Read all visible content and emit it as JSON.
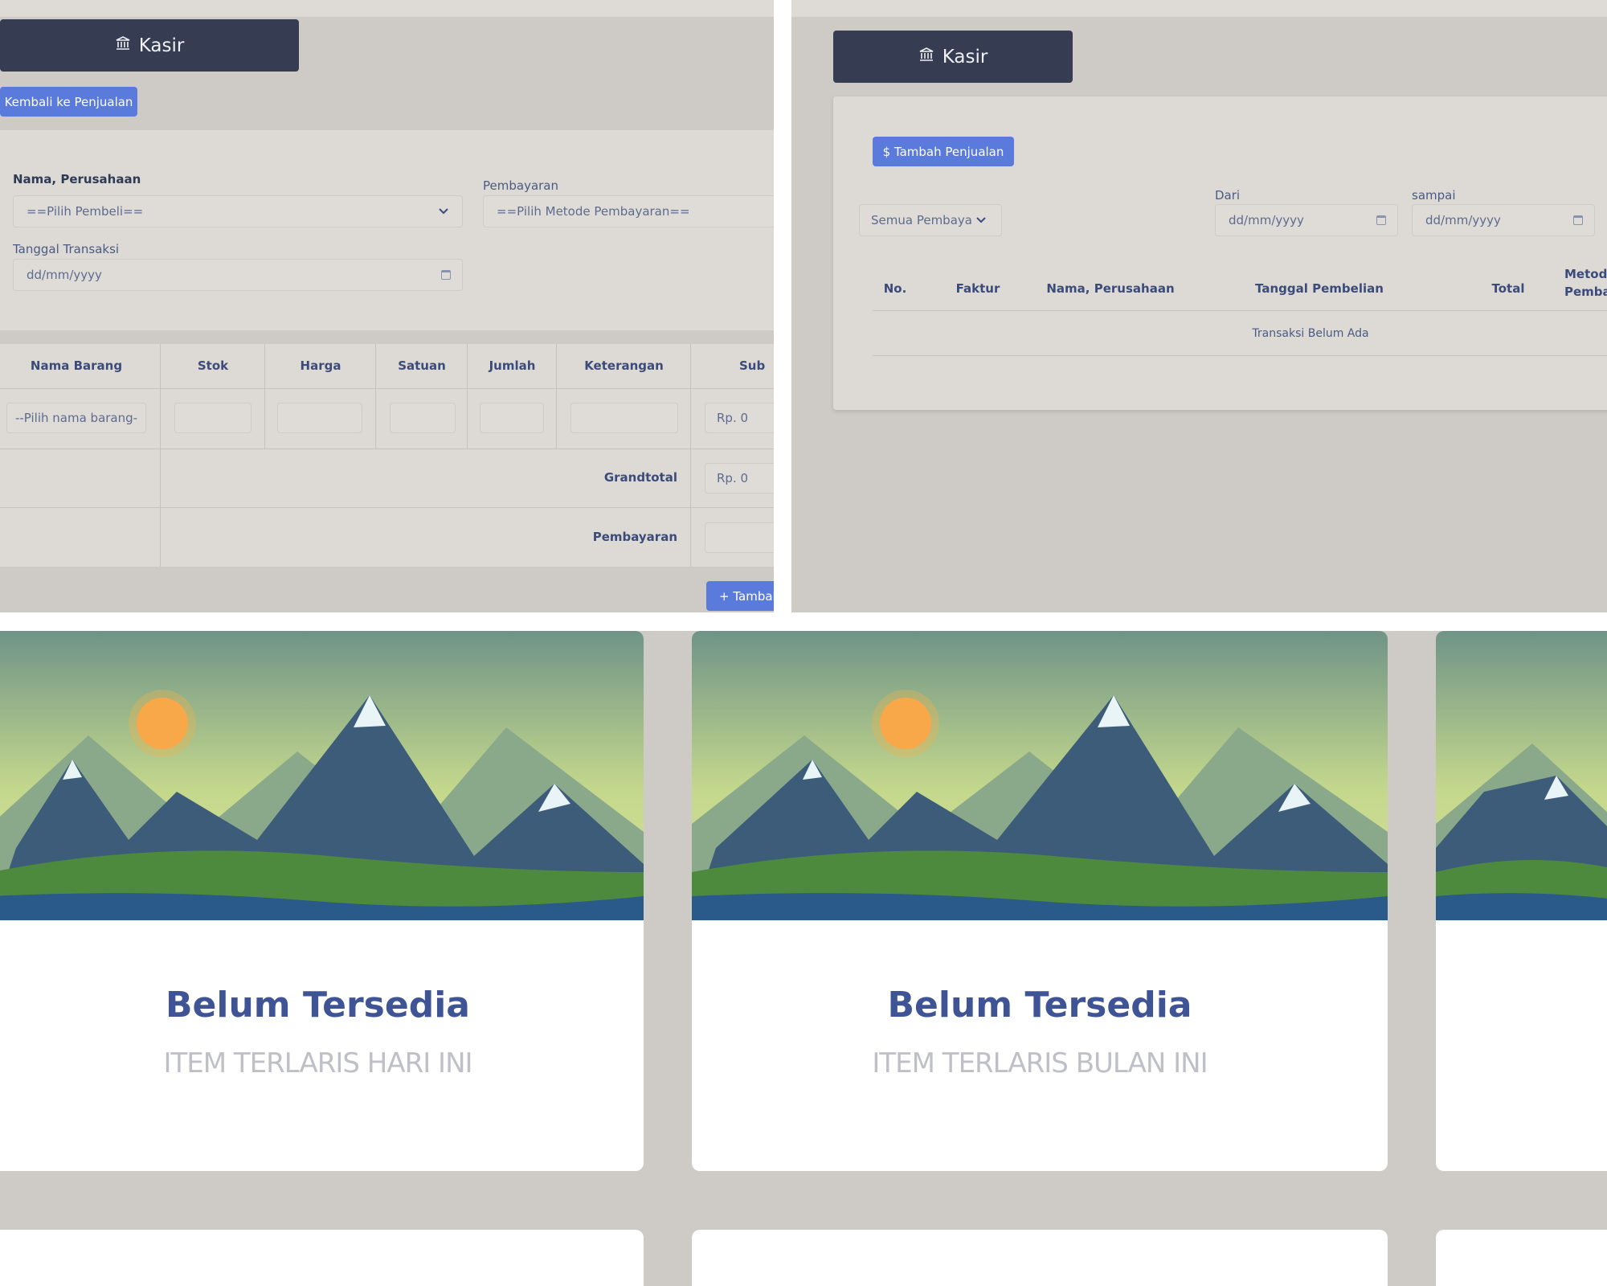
{
  "kasir_form": {
    "header_title": "Kasir",
    "back_button": "Kembali ke Penjualan",
    "customer_label": "Nama, Perusahaan",
    "customer_placeholder": "==Pilih Pembeli==",
    "payment_label": "Pembayaran",
    "payment_placeholder": "==Pilih Metode Pembayaran==",
    "date_label": "Tanggal Transaksi",
    "date_placeholder": "dd/mm/yyyy",
    "columns": [
      "Nama Barang",
      "Stok",
      "Harga",
      "Satuan",
      "Jumlah",
      "Keterangan",
      "Sub"
    ],
    "item_placeholder": "--Pilih nama barang-",
    "subtotal_value": "Rp. 0",
    "grandtotal_label": "Grandtotal",
    "grandtotal_value": "Rp. 0",
    "payment_row_label": "Pembayaran",
    "add_button": "+ Tambal"
  },
  "kasir_list": {
    "header_title": "Kasir",
    "add_sale_button": "$ Tambah Penjualan",
    "filter_select": "Semua Pembayara",
    "from_label": "Dari",
    "from_placeholder": "dd/mm/yyyy",
    "to_label": "sampai",
    "to_placeholder": "dd/mm/yyyy",
    "columns": [
      "No.",
      "Faktur",
      "Nama, Perusahaan",
      "Tanggal Pembelian",
      "Total"
    ],
    "col_metode_line1": "Metode",
    "col_metode_line2": "Pembay",
    "empty_message": "Transaksi Belum Ada"
  },
  "dashboard": {
    "cards": [
      {
        "title": "Belum Tersedia",
        "subtitle": "ITEM TERLARIS HARI INI"
      },
      {
        "title": "Belum Tersedia",
        "subtitle": "ITEM TERLARIS BULAN INI"
      }
    ]
  }
}
